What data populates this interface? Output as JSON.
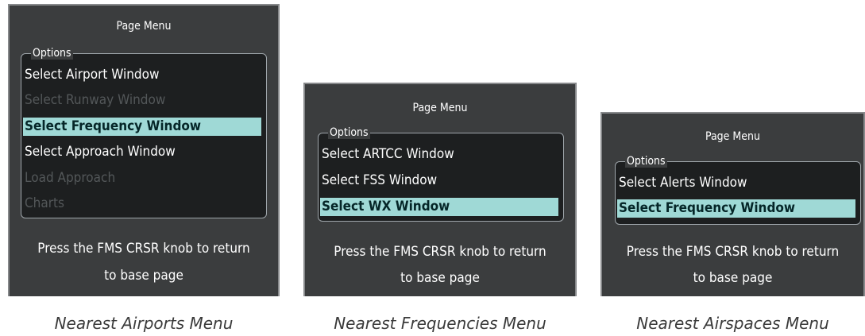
{
  "panels": [
    {
      "title": "Page Menu",
      "options_label": "Options",
      "items": [
        {
          "label": "Select Airport Window",
          "state": "enabled"
        },
        {
          "label": "Select Runway Window",
          "state": "disabled"
        },
        {
          "label": "Select Frequency Window",
          "state": "selected"
        },
        {
          "label": "Select Approach Window",
          "state": "enabled"
        },
        {
          "label": "Load Approach",
          "state": "disabled"
        },
        {
          "label": "Charts",
          "state": "disabled"
        }
      ],
      "footer_line1": "Press the FMS CRSR knob to return",
      "footer_line2": "to base page",
      "caption": "Nearest Airports Menu"
    },
    {
      "title": "Page Menu",
      "options_label": "Options",
      "items": [
        {
          "label": "Select ARTCC Window",
          "state": "enabled"
        },
        {
          "label": "Select FSS Window",
          "state": "enabled"
        },
        {
          "label": "Select WX Window",
          "state": "selected"
        }
      ],
      "footer_line1": "Press the FMS CRSR knob to return",
      "footer_line2": "to base page",
      "caption": "Nearest Frequencies Menu"
    },
    {
      "title": "Page Menu",
      "options_label": "Options",
      "items": [
        {
          "label": "Select Alerts Window",
          "state": "enabled"
        },
        {
          "label": "Select Frequency Window",
          "state": "selected"
        }
      ],
      "footer_line1": "Press the FMS CRSR knob to return",
      "footer_line2": "to base page",
      "caption": "Nearest Airspaces Menu"
    }
  ]
}
